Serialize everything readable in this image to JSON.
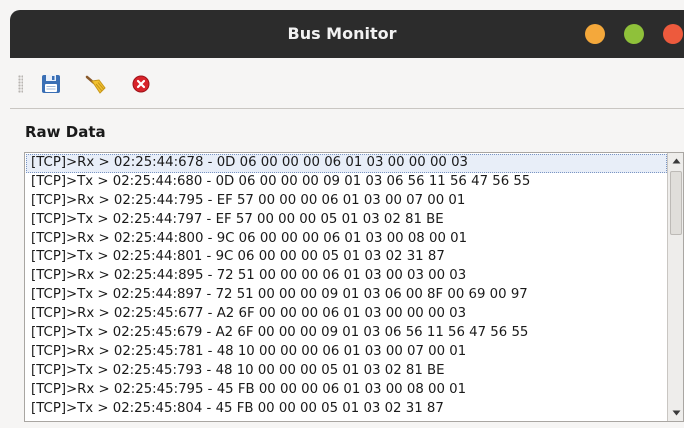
{
  "window": {
    "title": "Bus Monitor"
  },
  "section": {
    "label": "Raw Data"
  },
  "log": {
    "selected_index": 0,
    "rows": [
      "[TCP]>Rx > 02:25:44:678 - 0D 06 00 00 00 06 01 03 00 00 00 03",
      "[TCP]>Tx > 02:25:44:680 - 0D 06 00 00 00 09 01 03 06 56 11 56 47 56 55",
      "[TCP]>Rx > 02:25:44:795 - EF 57 00 00 00 06 01 03 00 07 00 01",
      "[TCP]>Tx > 02:25:44:797 - EF 57 00 00 00 05 01 03 02 81 BE",
      "[TCP]>Rx > 02:25:44:800 - 9C 06 00 00 00 06 01 03 00 08 00 01",
      "[TCP]>Tx > 02:25:44:801 - 9C 06 00 00 00 05 01 03 02 31 87",
      "[TCP]>Rx > 02:25:44:895 - 72 51 00 00 00 06 01 03 00 03 00 03",
      "[TCP]>Tx > 02:25:44:897 - 72 51 00 00 00 09 01 03 06 00 8F 00 69 00 97",
      "[TCP]>Rx > 02:25:45:677 - A2 6F 00 00 00 06 01 03 00 00 00 03",
      "[TCP]>Tx > 02:25:45:679 - A2 6F 00 00 00 09 01 03 06 56 11 56 47 56 55",
      "[TCP]>Rx > 02:25:45:781 - 48 10 00 00 00 06 01 03 00 07 00 01",
      "[TCP]>Tx > 02:25:45:793 - 48 10 00 00 00 05 01 03 02 81 BE",
      "[TCP]>Rx > 02:25:45:795 - 45 FB 00 00 00 06 01 03 00 08 00 01",
      "[TCP]>Tx > 02:25:45:804 - 45 FB 00 00 00 05 01 03 02 31 87"
    ]
  },
  "toolbar": {
    "buttons": [
      {
        "icon": "save-icon"
      },
      {
        "icon": "broom-icon"
      },
      {
        "icon": "stop-icon"
      }
    ]
  },
  "colors": {
    "titlebar": "#2c2c2c",
    "minimize": "#f4a83b",
    "maximize": "#8fc13a",
    "close": "#ed5a3d",
    "selection": "#e8eef8"
  }
}
